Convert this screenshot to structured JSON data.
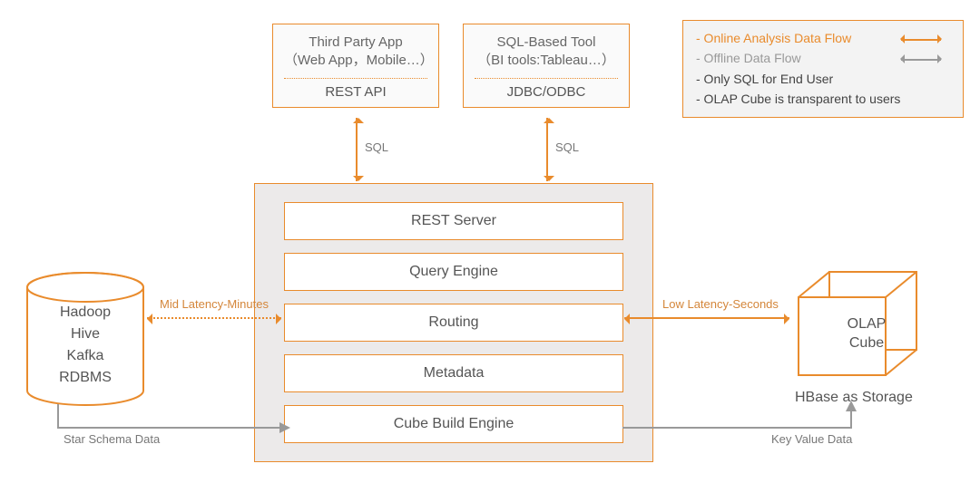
{
  "legend": {
    "online": "- Online Analysis Data Flow",
    "offline": "- Offline Data Flow",
    "line3": "- Only SQL for End User",
    "line4": "- OLAP Cube is transparent to users"
  },
  "clients": {
    "thirdParty": {
      "title": "Third Party App\n（Web App，Mobile…）",
      "api": "REST API"
    },
    "sqlTool": {
      "title": "SQL-Based Tool\n（BI tools:Tableau…）",
      "api": "JDBC/ODBC"
    }
  },
  "sqlLabel": "SQL",
  "core": {
    "blocks": [
      "REST Server",
      "Query Engine",
      "Routing",
      "Metadata",
      "Cube Build Engine"
    ]
  },
  "sources": {
    "stack": "Hadoop\nHive\nKafka\nRDBMS",
    "midLatency": "Mid Latency-Minutes",
    "starSchema": "Star Schema Data"
  },
  "cube": {
    "lowLatency": "Low Latency-Seconds",
    "title": "OLAP\nCube",
    "storage": "HBase  as Storage",
    "keyValue": "Key Value Data"
  },
  "colors": {
    "accent": "#e98b2c",
    "gray": "#999"
  }
}
